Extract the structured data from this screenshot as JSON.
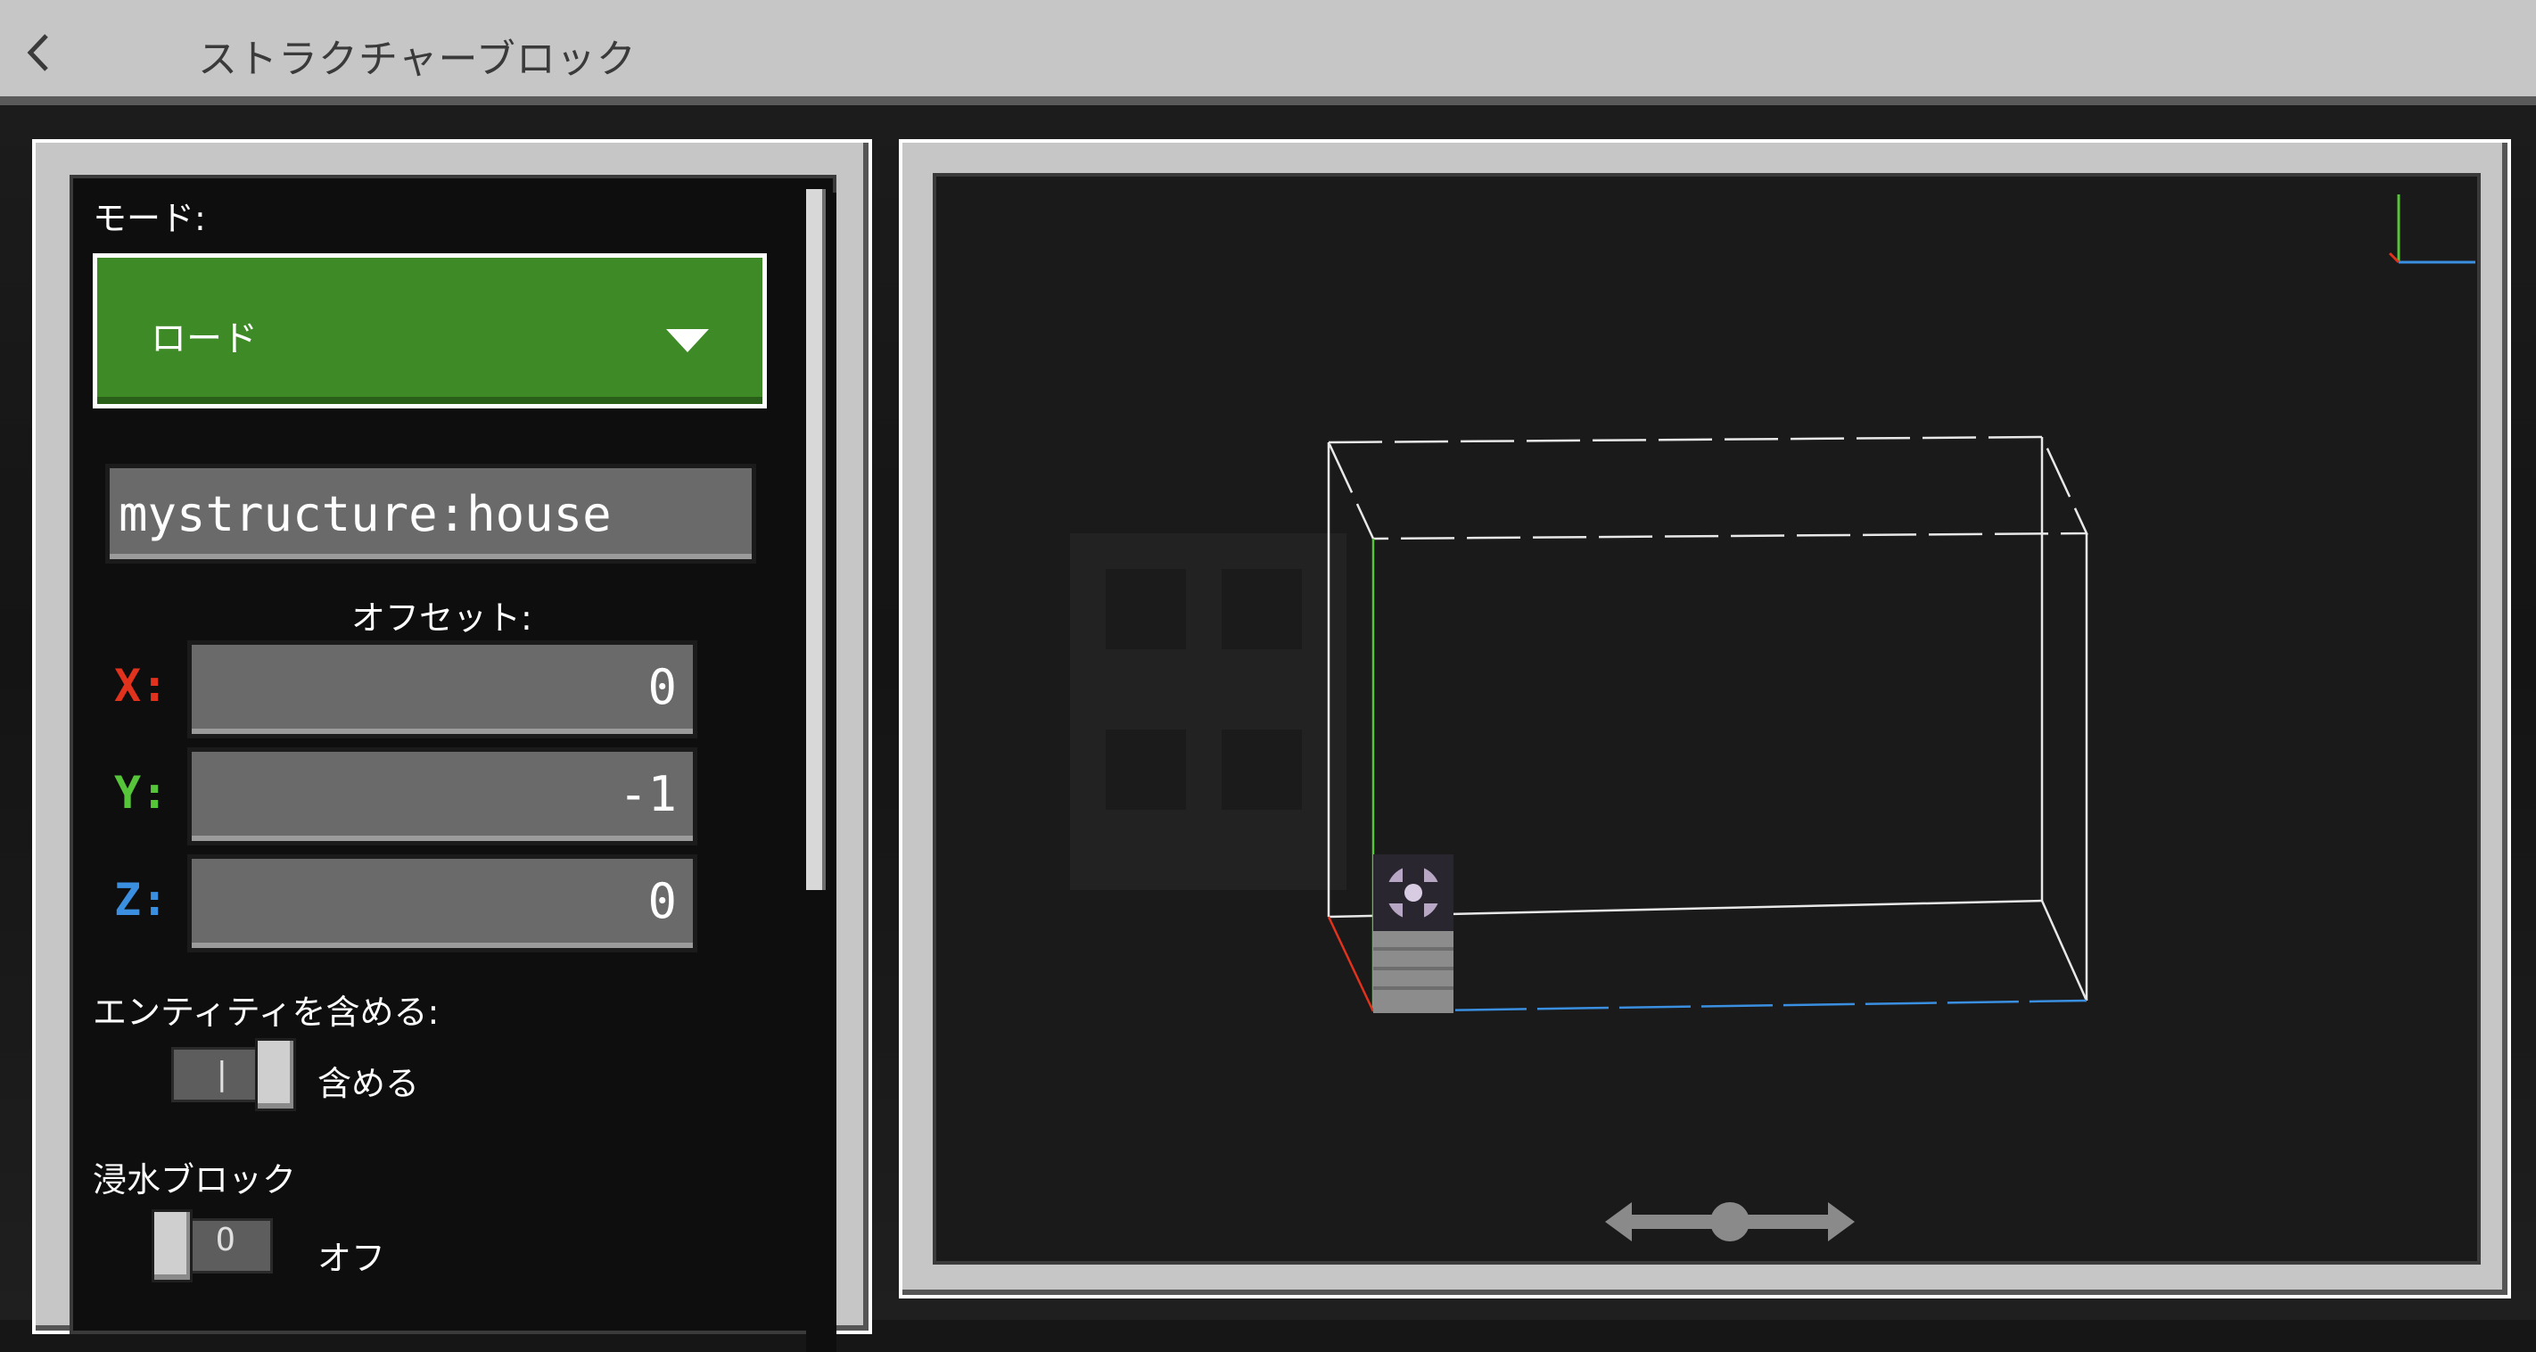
{
  "header": {
    "title": "ストラクチャーブロック"
  },
  "panel": {
    "mode_label": "モード:",
    "mode_value": "ロード",
    "structure_name": "mystructure:house",
    "offset_label": "オフセット:",
    "offset": {
      "x_label": "X:",
      "x_value": "0",
      "y_label": "Y:",
      "y_value": "-1",
      "z_label": "Z:",
      "z_value": "0"
    },
    "include_entities_label": "エンティティを含める:",
    "include_entities_state": "含める",
    "waterlogged_label": "浸水ブロック",
    "waterlogged_state": "オフ"
  },
  "colors": {
    "mode_green": "#3e8a26",
    "x_axis": "#e0321c",
    "y_axis": "#56c53a",
    "z_axis": "#3a8fe0"
  },
  "icons": {
    "back": "chevron-left-icon",
    "dropdown": "triangle-down-icon",
    "rotate": "left-right-arrows-icon"
  }
}
